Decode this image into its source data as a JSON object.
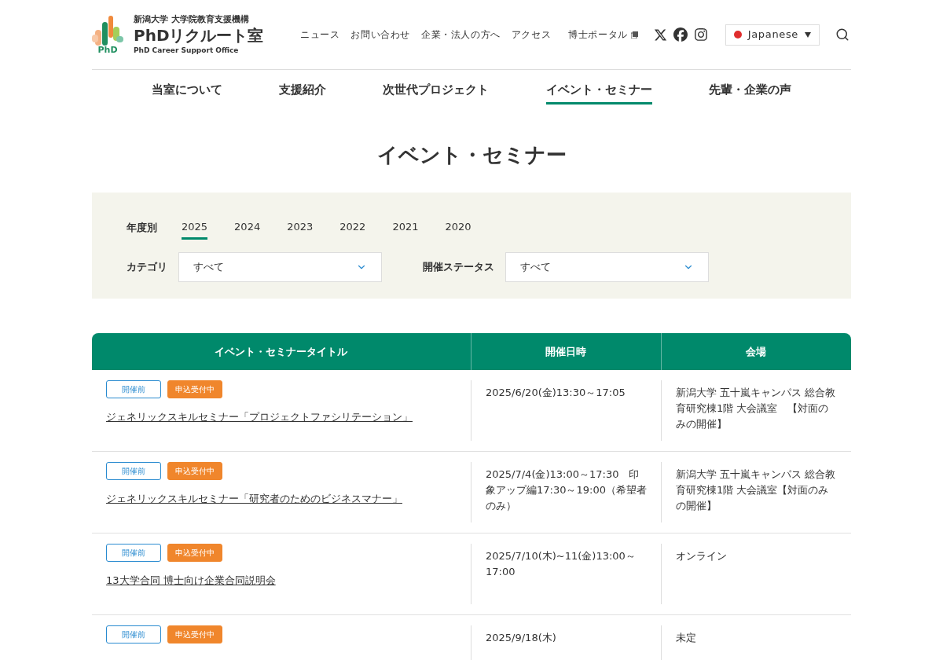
{
  "header": {
    "logo_mark": "PhD",
    "org": "新潟大学 大学院教育支援機構",
    "title": "PhDリクルート室",
    "subtitle": "PhD Career Support Office",
    "links": [
      {
        "label": "ニュース",
        "external": false
      },
      {
        "label": "お問い合わせ",
        "external": false
      },
      {
        "label": "企業・法人の方へ",
        "external": false
      },
      {
        "label": "アクセス",
        "external": false
      },
      {
        "label": "博士ポータル",
        "external": true
      }
    ],
    "language": "Japanese"
  },
  "main_nav": [
    {
      "label": "当室について",
      "selected": false
    },
    {
      "label": "支援紹介",
      "selected": false
    },
    {
      "label": "次世代プロジェクト",
      "selected": false
    },
    {
      "label": "イベント・セミナー",
      "selected": true
    },
    {
      "label": "先輩・企業の声",
      "selected": false
    }
  ],
  "page_title": "イベント・セミナー",
  "filters": {
    "year_label": "年度別",
    "years": [
      {
        "label": "2025",
        "selected": true
      },
      {
        "label": "2024",
        "selected": false
      },
      {
        "label": "2023",
        "selected": false
      },
      {
        "label": "2022",
        "selected": false
      },
      {
        "label": "2021",
        "selected": false
      },
      {
        "label": "2020",
        "selected": false
      }
    ],
    "selects": [
      {
        "label": "カテゴリ",
        "value": "すべて"
      },
      {
        "label": "開催ステータス",
        "value": "すべて"
      }
    ]
  },
  "table": {
    "columns": [
      "イベント・セミナータイトル",
      "開催日時",
      "会場"
    ],
    "rows": [
      {
        "badges": [
          {
            "label": "開催前",
            "kind": "outline"
          },
          {
            "label": "申込受付中",
            "kind": "filled"
          }
        ],
        "title": "ジェネリックスキルセミナー「プロジェクトファシリテーション」",
        "date": "2025/6/20(金)13:30～17:05",
        "venue": "新潟大学 五十嵐キャンパス 総合教育研究棟1階 大会議室　【対面のみの開催】"
      },
      {
        "badges": [
          {
            "label": "開催前",
            "kind": "outline"
          },
          {
            "label": "申込受付中",
            "kind": "filled"
          }
        ],
        "title": "ジェネリックスキルセミナー「研究者のためのビジネスマナー」",
        "date": "2025/7/4(金)13:00～17:30　印象アップ編17:30～19:00（希望者のみ）",
        "venue": "新潟大学 五十嵐キャンパス 総合教育研究棟1階 大会議室【対面のみの開催】"
      },
      {
        "badges": [
          {
            "label": "開催前",
            "kind": "outline"
          },
          {
            "label": "申込受付中",
            "kind": "filled"
          }
        ],
        "title": "13大学合同 博士向け企業合同説明会",
        "date": "2025/7/10(木)~11(金)13:00～17:00",
        "venue": "オンライン"
      },
      {
        "badges": [
          {
            "label": "開催前",
            "kind": "outline"
          },
          {
            "label": "申込受付中",
            "kind": "filled"
          }
        ],
        "date": "2025/9/18(木)",
        "venue": "未定"
      }
    ]
  }
}
